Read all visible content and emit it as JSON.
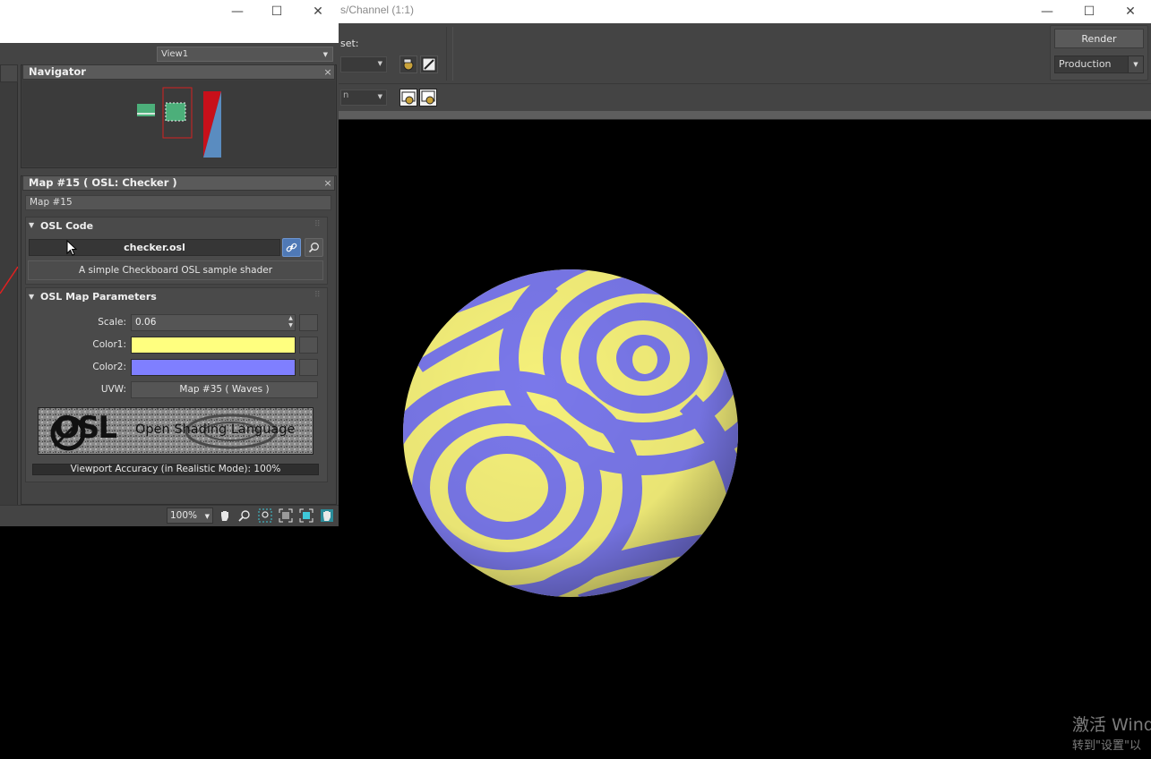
{
  "render_window": {
    "title_fragment": "s/Channel (1:1)",
    "window_controls": {
      "minimize": "—",
      "maximize": "☐",
      "close": "✕"
    },
    "preset_label": "set:",
    "render_button": "Render",
    "production_dropdown": "Production"
  },
  "material_editor": {
    "window_controls": {
      "minimize": "—",
      "maximize": "☐",
      "close": "✕"
    },
    "view_tab": "View1",
    "navigator": {
      "title": "Navigator",
      "close": "×"
    },
    "map_panel": {
      "title": "Map #15  ( OSL: Checker )",
      "close": "×",
      "map_name": "Map #15",
      "osl_code": {
        "title": "OSL Code",
        "file": "checker.osl",
        "description": "A simple Checkboard OSL sample shader"
      },
      "parameters": {
        "title": "OSL Map Parameters",
        "scale_label": "Scale:",
        "scale_value": "0.06",
        "color1_label": "Color1:",
        "color1": "#ffff7f",
        "color2_label": "Color2:",
        "color2": "#7f7fff",
        "uvw_label": "UVW:",
        "uvw_value": "Map #35  ( Waves )"
      },
      "logo_text": "Open Shading Language",
      "logo_mark": "OSL",
      "accuracy": "Viewport Accuracy (in Realistic Mode): 100%"
    },
    "status": {
      "zoom": "100%"
    }
  },
  "watermark": {
    "line1": "激活 Wind",
    "line2": "转到\"设置\"以"
  },
  "sphere_colors": {
    "yellow": "#f5f07a",
    "blue": "#7a78ea"
  },
  "icons": [
    "link-icon",
    "search-icon",
    "pan-hand-icon",
    "zoom-icon",
    "zoom-region-icon",
    "zoom-extents-icon",
    "zoom-extents-selected-icon",
    "pan-to-selected-icon",
    "render-setup-icon",
    "environment-icon",
    "render-frame-icon",
    "copy-image-icon"
  ]
}
